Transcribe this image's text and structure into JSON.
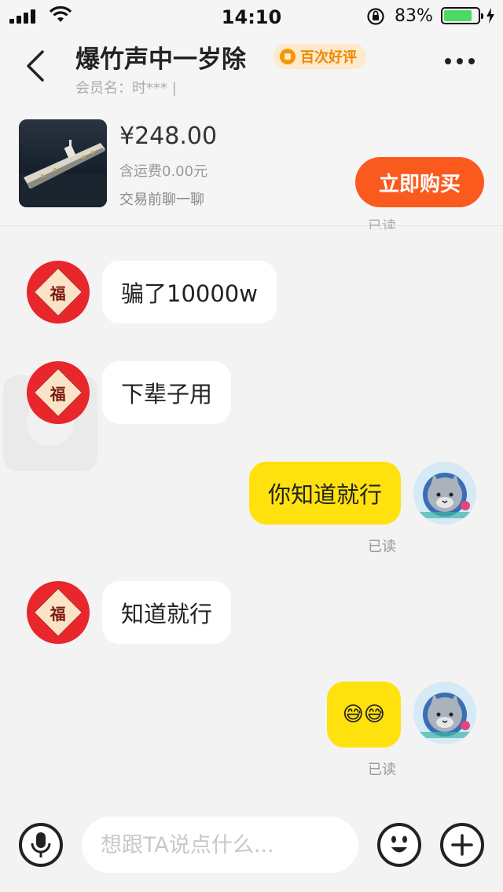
{
  "status_bar": {
    "time": "14:10",
    "battery_percent": "83%",
    "battery_level": 0.83
  },
  "header": {
    "title": "爆竹声中一岁除",
    "badge": "百次好评",
    "member": "会员名：时*** |"
  },
  "product": {
    "price": "¥248.00",
    "shipping": "含运费0.00元",
    "chat_hint": "交易前聊一聊",
    "buy_label": "立即购买",
    "clipped_read": "已读"
  },
  "messages": [
    {
      "side": "left",
      "text": "骗了10000w"
    },
    {
      "side": "left",
      "text": "下辈子用"
    },
    {
      "side": "right",
      "text": "你知道就行",
      "status": "已读"
    },
    {
      "side": "left",
      "text": "知道就行"
    },
    {
      "side": "right",
      "text": "😅😅",
      "status": "已读"
    }
  ],
  "avatar_fu_char": "福",
  "input": {
    "placeholder": "想跟TA说点什么..."
  },
  "colors": {
    "buy_button": "#fb5a1f",
    "my_bubble": "#ffe20d",
    "badge_text": "#ee8800"
  }
}
